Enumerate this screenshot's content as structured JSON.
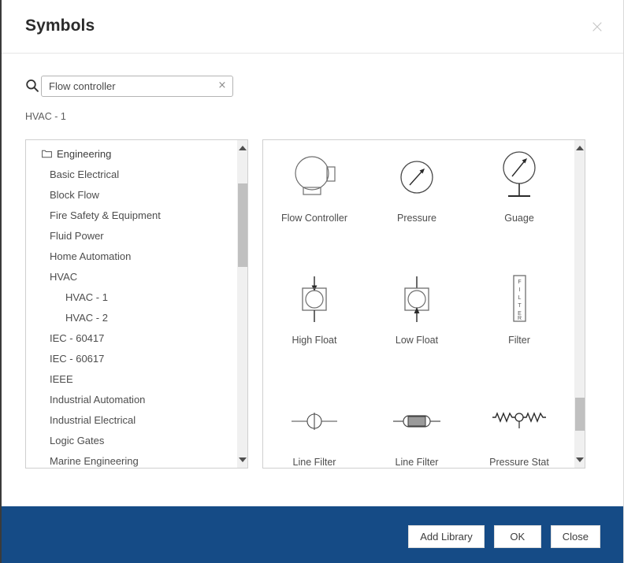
{
  "dialog": {
    "title": "Symbols",
    "close_label": "×"
  },
  "search": {
    "value": "Flow controller",
    "placeholder": "Search shapes",
    "clear_label": "×",
    "icon": "search-icon"
  },
  "breadcrumb": "HVAC - 1",
  "tree": {
    "items": [
      {
        "label": "Engineering",
        "level": 0,
        "icon": "folder-icon"
      },
      {
        "label": "Basic Electrical",
        "level": 1
      },
      {
        "label": "Block Flow",
        "level": 1
      },
      {
        "label": "Fire Safety & Equipment",
        "level": 1
      },
      {
        "label": "Fluid Power",
        "level": 1
      },
      {
        "label": "Home Automation",
        "level": 1
      },
      {
        "label": "HVAC",
        "level": 1
      },
      {
        "label": "HVAC - 1",
        "level": 2
      },
      {
        "label": "HVAC - 2",
        "level": 2
      },
      {
        "label": "IEC - 60417",
        "level": 1
      },
      {
        "label": "IEC - 60617",
        "level": 1
      },
      {
        "label": "IEEE",
        "level": 1
      },
      {
        "label": "Industrial Automation",
        "level": 1
      },
      {
        "label": "Industrial Electrical",
        "level": 1
      },
      {
        "label": "Logic Gates",
        "level": 1
      },
      {
        "label": "Marine Engineering",
        "level": 1
      }
    ]
  },
  "symbols": {
    "rows": [
      [
        {
          "label": "Flow Controller",
          "art": "flow-controller"
        },
        {
          "label": "Pressure",
          "art": "pressure"
        },
        {
          "label": "Guage",
          "art": "guage"
        }
      ],
      [
        {
          "label": "High Float",
          "art": "high-float"
        },
        {
          "label": "Low Float",
          "art": "low-float"
        },
        {
          "label": "Filter",
          "art": "filter"
        }
      ],
      [
        {
          "label": "Line Filter",
          "art": "line-filter-a"
        },
        {
          "label": "Line Filter",
          "art": "line-filter-b"
        },
        {
          "label": "Pressure Stat",
          "art": "pressure-stat"
        }
      ]
    ],
    "filter_text": "FILTER"
  },
  "footer": {
    "add_library_label": "Add Library",
    "ok_label": "OK",
    "close_label": "Close",
    "background_color": "#154B86"
  }
}
